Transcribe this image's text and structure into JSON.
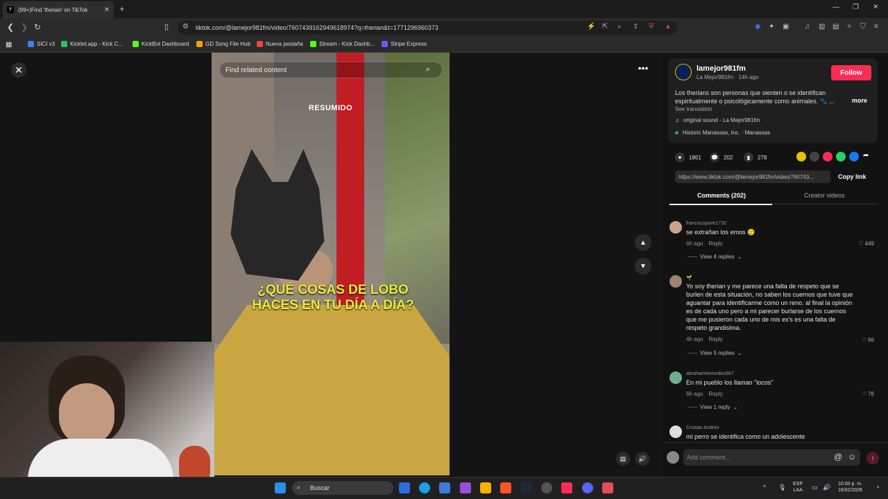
{
  "browser": {
    "tab_title": "(99+)Find 'therian' on TikTok",
    "tab_favicon": "T",
    "new_tab": "+",
    "url": "tiktok.com/@lamejor981fm/video/7607439162949618974?q=therian&t=1771296960373",
    "bookmarks": [
      {
        "label": "SICI v3",
        "color": "#3b82f6"
      },
      {
        "label": "Kicklet.app - Kick C...",
        "color": "#22c55e"
      },
      {
        "label": "KickBot Dashboard",
        "color": "#53fc18"
      },
      {
        "label": "GD Song File Hub",
        "color": "#f59e0b"
      },
      {
        "label": "Nueva pestaña",
        "color": "#ef4444"
      },
      {
        "label": "Stream - Kick Dashb...",
        "color": "#53fc18"
      },
      {
        "label": "Stripe Express",
        "color": "#635bff"
      }
    ]
  },
  "video": {
    "search_placeholder": "Find related content",
    "overlay_title": "RESUMIDO",
    "headline": "¿QUÉ COSAS DE LOBO HACES EN TU DÍA A DÍA?"
  },
  "post": {
    "author": "lamejor981fm",
    "subline": "La Mejor981fm · 14h ago",
    "follow_label": "Follow",
    "description": "Los therians son personas que sienten o se identifican espiritualmente o psicológicamente como animales. 🐾 ...",
    "more_label": "more",
    "see_translation": "See translation",
    "sound": "original sound - La Mejor981fm",
    "location": "Historic Manassas, Inc. · Manassas",
    "likes": "1861",
    "comments_count": "202",
    "saves": "278",
    "link": "https://www.tiktok.com/@lamejor981fm/video/760743...",
    "copy_link_label": "Copy link",
    "tab_comments": "Comments (202)",
    "tab_creator": "Creator videos",
    "brand_color": "#fe2c55"
  },
  "comments": [
    {
      "user": "franciscojavie1732",
      "text": "se extrañan los emos 🥲",
      "time": "6h ago",
      "reply": "Reply",
      "likes": "449",
      "replies": "View 4 replies"
    },
    {
      "user": "🌱",
      "text": "Yo soy therian y me parece una falta de respeto que se burlen de esta situación, no saben los cuernos que tuve que aguantar para identificarme como un reno. al final la opinión es de cada uno pero a mi parecer burlarse de los cuernos que me pusieron cada uno de mis ex's es una falta de respeto grandisima.",
      "time": "4h ago",
      "reply": "Reply",
      "likes": "66",
      "replies": "View 5 replies"
    },
    {
      "user": "abrahamhernndez667",
      "text": "En mi pueblo los llaman \"locos\"",
      "time": "6h ago",
      "reply": "Reply",
      "likes": "78",
      "replies": "View 1 reply"
    },
    {
      "user": "Cristian Andres",
      "text": "mi perro se identifica como un adolescente"
    }
  ],
  "add_comment_placeholder": "Add comment...",
  "taskbar": {
    "search_label": "Buscar",
    "lang_top": "ESP",
    "lang_bottom": "LAA",
    "time": "10:00 p. m.",
    "date": "16/02/2026"
  }
}
